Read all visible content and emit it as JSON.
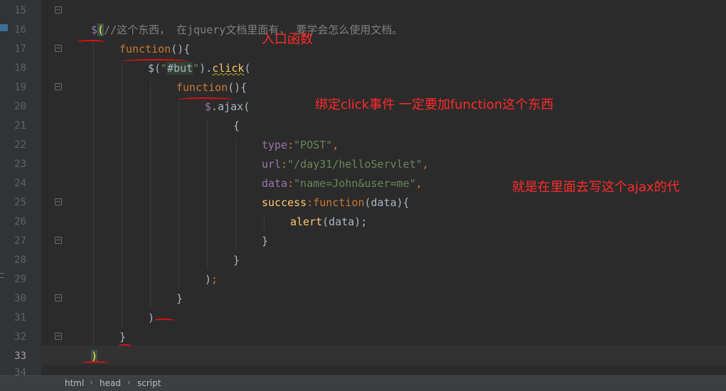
{
  "editor": {
    "line_numbers": [
      "15",
      "16",
      "17",
      "18",
      "19",
      "20",
      "21",
      "22",
      "23",
      "24",
      "25",
      "26",
      "27",
      "28",
      "29",
      "30",
      "31",
      "32",
      "33",
      "34"
    ],
    "current_line": "33",
    "lines": {
      "l15_comment": "//这个东西， 在jquery文档里面有， 要学会怎么使用文档。",
      "l16_dollar": "$",
      "l16_paren": "(",
      "l17_function": "function",
      "l17_rest": "(){",
      "l18_dollar": "$(",
      "l18_str_q1": "\"",
      "l18_str_sel": "#but",
      "l18_str_q2": "\"",
      "l18_close": ").",
      "l18_click": "click",
      "l18_open": "(",
      "l19_function": "function",
      "l19_rest": "(){",
      "l20_dollar": "$",
      "l20_dot": ".",
      "l20_ajax": "ajax",
      "l20_open": "(",
      "l21_brace": "{",
      "l22_key": "type",
      "l22_colon": ":",
      "l22_val": "\"POST\"",
      "l22_comma": ",",
      "l23_key": "url",
      "l23_colon": ":",
      "l23_val": "\"/day31/helloServlet\"",
      "l23_comma": ",",
      "l24_key": "data",
      "l24_colon": ":",
      "l24_val": "\"name=John&user=me\"",
      "l24_comma": ",",
      "l25_key": "success",
      "l25_colon": ":",
      "l25_function": "function",
      "l25_rest": "(data){",
      "l26_alert": "alert",
      "l26_rest": "(data);",
      "l27_brace": "}",
      "l28_brace": "}",
      "l29_paren": ")",
      "l29_semi": ";",
      "l30_brace": "}",
      "l31_paren": ")",
      "l32_brace": "}",
      "l33_paren": ")"
    }
  },
  "annotations": {
    "entry_function": "入口函数",
    "bind_click": "绑定click事件 一定要加function这个东西",
    "write_ajax": "就是在里面去写这个ajax的代"
  },
  "breadcrumb": [
    "html",
    "head",
    "script"
  ],
  "colors": {
    "background": "#2b2b2b",
    "gutter": "#313335",
    "keyword": "#cc7832",
    "string": "#6a8759",
    "property": "#9876aa",
    "function_call": "#ffc66d",
    "comment": "#808080",
    "annotation": "#ff2a2a"
  }
}
